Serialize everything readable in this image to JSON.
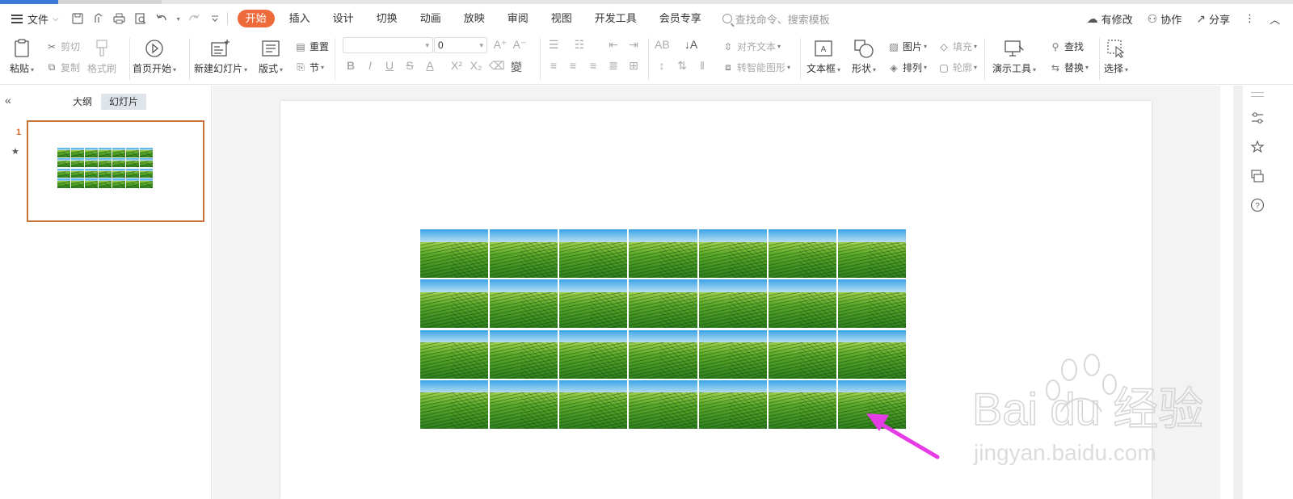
{
  "menu": {
    "file_label": "文件",
    "tabs": [
      "开始",
      "插入",
      "设计",
      "切换",
      "动画",
      "放映",
      "审阅",
      "视图",
      "开发工具",
      "会员专享"
    ],
    "search_placeholder": "查找命令、搜索模板",
    "right": {
      "modified": "有修改",
      "collab": "协作",
      "share": "分享"
    }
  },
  "ribbon": {
    "paste": "粘贴",
    "cut": "剪切",
    "copy": "复制",
    "format_painter": "格式刷",
    "from_start": "首页开始",
    "new_slide": "新建幻灯片",
    "layout": "版式",
    "reset": "重置",
    "section": "节",
    "font_size": "0",
    "align_text": "对齐文本",
    "smart_shape": "转智能图形",
    "textbox": "文本框",
    "shape": "形状",
    "picture": "图片",
    "arrange": "排列",
    "fill": "填充",
    "outline": "轮廓",
    "present_tools": "演示工具",
    "find": "查找",
    "replace": "替换",
    "select": "选择"
  },
  "leftpanel": {
    "outline_tab": "大纲",
    "slides_tab": "幻灯片",
    "slide_number": "1"
  },
  "slide": {
    "grid_rows": 4,
    "grid_cols": 7
  },
  "colors": {
    "accent": "#ef6a3a",
    "arrow": "#e63ce6",
    "thumb_border": "#c9733a"
  },
  "watermark": {
    "brand": "Bai du 经验",
    "url": "jingyan.baidu.com"
  }
}
